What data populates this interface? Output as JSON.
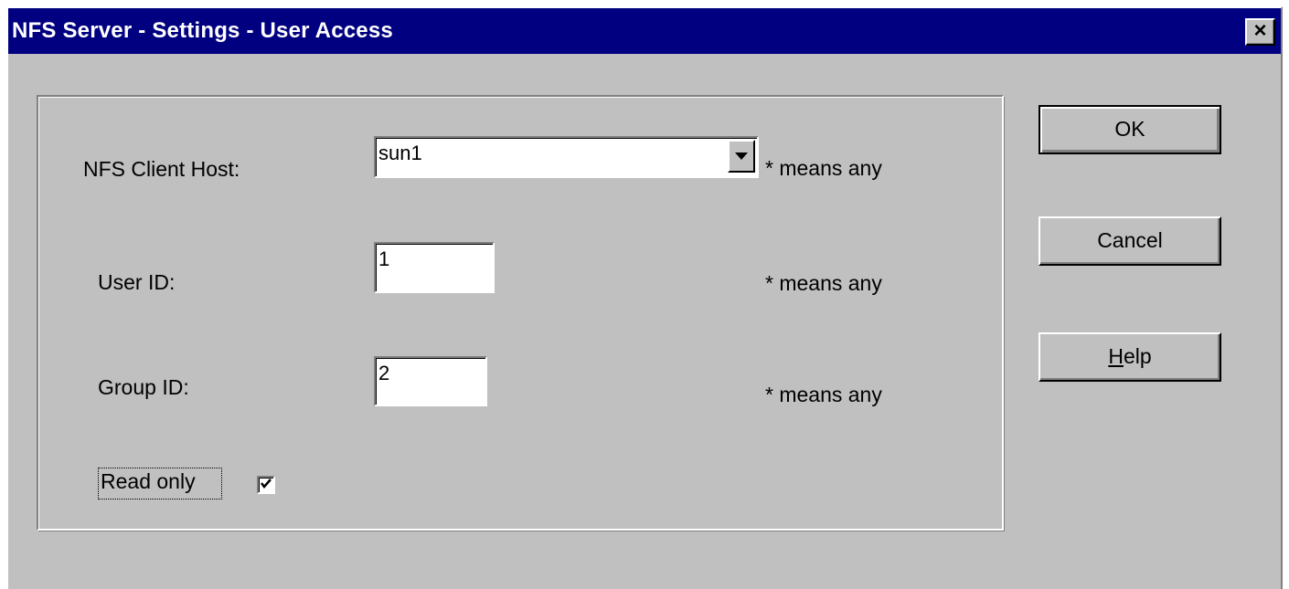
{
  "window": {
    "title": "NFS Server - Settings - User Access",
    "close_icon": "close-x-icon",
    "close_label": "×"
  },
  "form": {
    "host_label": "NFS Client Host:",
    "host_value": "sun1",
    "host_hint": "* means any",
    "user_label": "User ID:",
    "user_value": "1",
    "user_hint": "* means any",
    "group_label": "Group ID:",
    "group_value": "2",
    "group_hint": "* means any",
    "readonly_label": "Read only",
    "readonly_checked": true
  },
  "buttons": {
    "ok_label": "OK",
    "cancel_label": "Cancel",
    "help_label_prefix": "H",
    "help_label_rest": "elp"
  }
}
